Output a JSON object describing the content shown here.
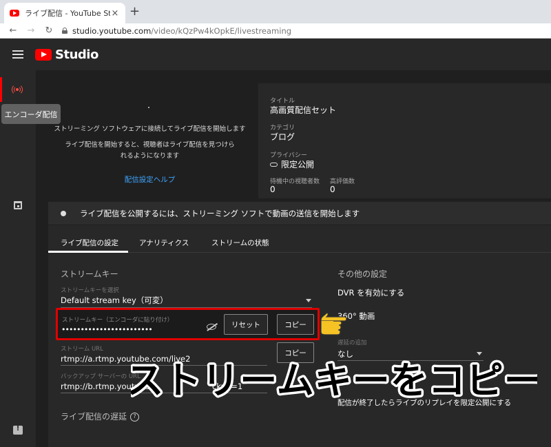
{
  "browser": {
    "tab_title": "ライブ配信 - YouTube Studio",
    "tab_close": "×",
    "new_tab": "+",
    "url_host": "studio.youtube.com",
    "url_path": "/video/kQzPw4kOpkE/livestreaming"
  },
  "header": {
    "logo_text": "Studio"
  },
  "rail": {
    "tooltip": "エンコーダ配信"
  },
  "preview": {
    "line1": "ストリーミング ソフトウェアに接続してライブ配信を開始します",
    "line2": "ライブ配信を開始すると、視聴者はライブ配信を見つけられるようになります",
    "help_link": "配信設定ヘルプ"
  },
  "info": {
    "title_label": "タイトル",
    "title_value": "高画質配信セット",
    "category_label": "カテゴリ",
    "category_value": "ブログ",
    "privacy_label": "プライバシー",
    "privacy_value": "限定公開",
    "waiting_label": "待機中の視聴者数",
    "waiting_value": "0",
    "likes_label": "高評価数",
    "likes_value": "0"
  },
  "status": {
    "text": "ライブ配信を公開するには、ストリーミング ソフトで動画の送信を開始します"
  },
  "tabs": [
    {
      "label": "ライブ配信の設定"
    },
    {
      "label": "アナリティクス"
    },
    {
      "label": "ストリームの状態"
    }
  ],
  "stream_key": {
    "section_title": "ストリームキー",
    "select_label": "ストリームキーを選択",
    "select_value": "Default stream key（可変）",
    "key_label": "ストリームキー（エンコーダに貼り付け）",
    "key_value": "••••••••••••••••••••••••",
    "reset_label": "リセット",
    "copy_label": "コピー",
    "url_label": "ストリーム URL",
    "url_value": "rtmp://a.rtmp.youtube.com/live2",
    "url_copy_label": "コピー",
    "backup_label": "バックアップ サーバーの URL",
    "backup_value_a": "rtmp://b.rtmp.youtube",
    "backup_value_b": "ckup=1",
    "latency_label": "ライブ配信の遅延",
    "help_mark": "?"
  },
  "other": {
    "section_title": "その他の設定",
    "dvr_label": "DVR を有効にする",
    "vr360_label": "360° 動画",
    "delay_label": "遅延の追加",
    "delay_value": "なし",
    "replay_label": "配信が終了したらライブのリプレイを限定公開にする"
  },
  "overlay": {
    "banner_text": "ストリームキーをコピー"
  },
  "colors": {
    "accent_red": "#e00000",
    "link_blue": "#3ea6ff",
    "banner_fill": "#000000",
    "banner_stroke": "#ffffff"
  }
}
